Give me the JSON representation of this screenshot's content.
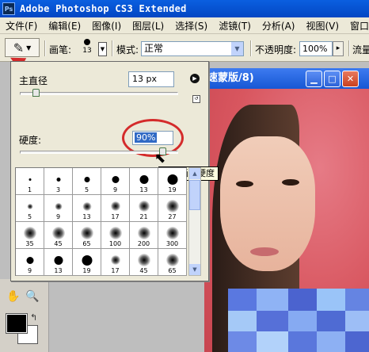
{
  "app": {
    "icon_text": "Ps",
    "title": "Adobe Photoshop CS3 Extended"
  },
  "menu": [
    "文件(F)",
    "编辑(E)",
    "图像(I)",
    "图层(L)",
    "选择(S)",
    "滤镜(T)",
    "分析(A)",
    "视图(V)",
    "窗口"
  ],
  "options": {
    "brush_label": "画笔:",
    "brush_size": "13",
    "mode_label": "模式:",
    "mode_value": "正常",
    "opacity_label": "不透明度:",
    "opacity_value": "100%",
    "flow_label": "流量"
  },
  "document": {
    "title": "速蒙版/8)",
    "min_icon": "minimize-icon",
    "max_icon": "maximize-icon",
    "close_icon": "close-icon"
  },
  "brush_picker": {
    "diameter_label": "主直径",
    "diameter_value": "13 px",
    "diameter_level": 0.1,
    "hardness_label": "硬度:",
    "hardness_value": "90%",
    "hardness_level": 0.9,
    "tooltip": "设置画笔硬度",
    "presets": [
      {
        "size": "1",
        "soft": false
      },
      {
        "size": "3",
        "soft": false
      },
      {
        "size": "5",
        "soft": false
      },
      {
        "size": "9",
        "soft": false
      },
      {
        "size": "13",
        "soft": false
      },
      {
        "size": "19",
        "soft": false
      },
      {
        "size": "5",
        "soft": true
      },
      {
        "size": "9",
        "soft": true
      },
      {
        "size": "13",
        "soft": true
      },
      {
        "size": "17",
        "soft": true
      },
      {
        "size": "21",
        "soft": true
      },
      {
        "size": "27",
        "soft": true
      },
      {
        "size": "35",
        "soft": true
      },
      {
        "size": "45",
        "soft": true
      },
      {
        "size": "65",
        "soft": true
      },
      {
        "size": "100",
        "soft": true
      },
      {
        "size": "200",
        "soft": true
      },
      {
        "size": "300",
        "soft": true
      },
      {
        "size": "9",
        "soft": false
      },
      {
        "size": "13",
        "soft": false
      },
      {
        "size": "19",
        "soft": false
      },
      {
        "size": "17",
        "soft": true
      },
      {
        "size": "45",
        "soft": true
      },
      {
        "size": "65",
        "soft": true
      }
    ]
  },
  "colors": {
    "foreground": "#000000",
    "background": "#ffffff",
    "annotation": "#d42b2b"
  }
}
